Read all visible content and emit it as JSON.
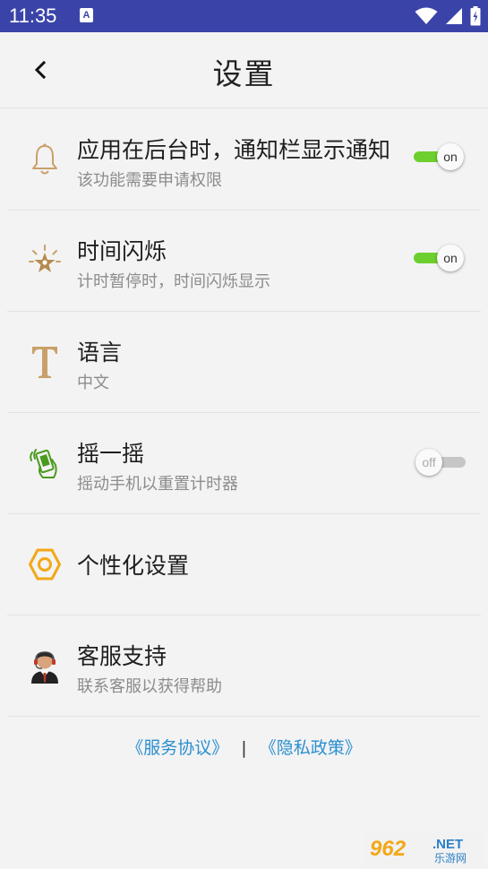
{
  "status_bar": {
    "time": "11:35",
    "notification_icon": "a-badge-icon",
    "icons": [
      "wifi-icon",
      "cellular-icon",
      "battery-icon"
    ]
  },
  "header": {
    "title": "设置",
    "back_icon": "chevron-left-icon"
  },
  "settings": [
    {
      "icon": "bell-icon",
      "title": "应用在后台时，通知栏显示通知",
      "desc": "该功能需要申请权限",
      "toggle": "on"
    },
    {
      "icon": "flashing-star-icon",
      "title": "时间闪烁",
      "desc": "计时暂停时，时间闪烁显示",
      "toggle": "on"
    },
    {
      "icon": "text-t-icon",
      "title": "语言",
      "desc": "中文"
    },
    {
      "icon": "shake-phone-icon",
      "title": "摇一摇",
      "desc": "摇动手机以重置计时器",
      "toggle": "off"
    },
    {
      "icon": "hexagon-nut-icon",
      "title": "个性化设置"
    },
    {
      "icon": "support-agent-icon",
      "title": "客服支持",
      "desc": "联系客服以获得帮助"
    }
  ],
  "footer": {
    "service_agreement": "《服务协议》",
    "separator": "|",
    "privacy_policy": "《隐私政策》"
  },
  "watermark": {
    "text_main": "962",
    "text_net": ".NET",
    "text_sub": "乐游网"
  },
  "colors": {
    "status_bar": "#3a44a8",
    "toggle_on": "#6ccf2e",
    "link": "#2a8fd0",
    "icon_tan": "#c9a06a",
    "icon_orange": "#f2a818",
    "icon_green": "#4a9a1e"
  }
}
